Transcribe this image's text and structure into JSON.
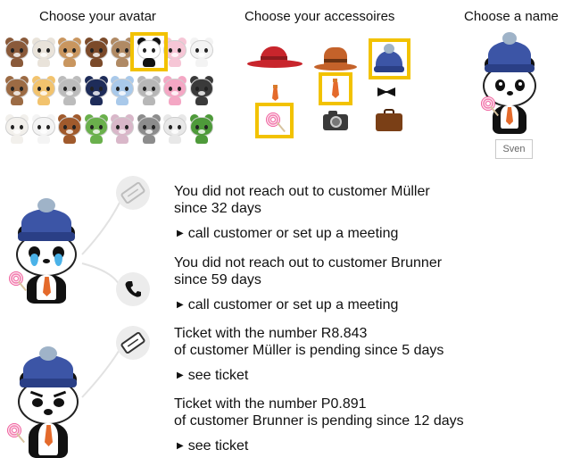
{
  "sections": {
    "avatar_heading": "Choose your avatar",
    "accessories_heading": "Choose your accessoires",
    "name_heading": "Choose a name"
  },
  "name_field": {
    "value": "Sven"
  },
  "avatars": {
    "rows": [
      [
        "#8a5a3a",
        "#e9e3da",
        "#c9965f",
        "#7b4a2a",
        "#b08a64",
        "#ffffff",
        "#f6c6d6",
        "#f3f3f3"
      ],
      [
        "#9c6b44",
        "#f2c36e",
        "#bcbcbc",
        "#1e2c59",
        "#a9c9ea",
        "#b7b7b7",
        "#f4a7c4",
        "#3a3a3a"
      ],
      [
        "#f2f0ec",
        "#f4f4f4",
        "#a05a2c",
        "#6ab04c",
        "#d9b7c9",
        "#8c8c8c",
        "#e8e8e8",
        "#4e9a3a"
      ]
    ],
    "selected": {
      "row": 0,
      "col": 5
    }
  },
  "accessories": [
    "red-hat",
    "brown-hat",
    "blue-beanie",
    "tie-small",
    "tie",
    "bowtie",
    "lollipop",
    "camera",
    "briefcase"
  ],
  "selected_accessories": [
    "blue-beanie",
    "tie",
    "lollipop"
  ],
  "notifications": [
    {
      "icon": "ticket-icon",
      "text_lines": [
        "You did not reach out to customer Müller",
        "since 32 days"
      ],
      "action": "call customer or set up a meeting"
    },
    {
      "icon": "phone-icon",
      "text_lines": [
        "You did not reach out to customer Brunner",
        "since 59 days"
      ],
      "action": "call customer or set up a meeting"
    },
    {
      "icon": "ticket-icon",
      "text_lines": [
        "Ticket with the number R8.843",
        "of customer Müller is pending since 5 days"
      ],
      "action": "see ticket"
    },
    {
      "icon": "ticket-icon",
      "text_lines": [
        "Ticket with the number P0.891",
        "of customer Brunner  is pending since 12 days"
      ],
      "action": "see ticket"
    }
  ],
  "colors": {
    "selection": "#f2c200",
    "beanie": "#3c55a6",
    "tie": "#e46a2b",
    "icon_bg": "#ececec"
  }
}
